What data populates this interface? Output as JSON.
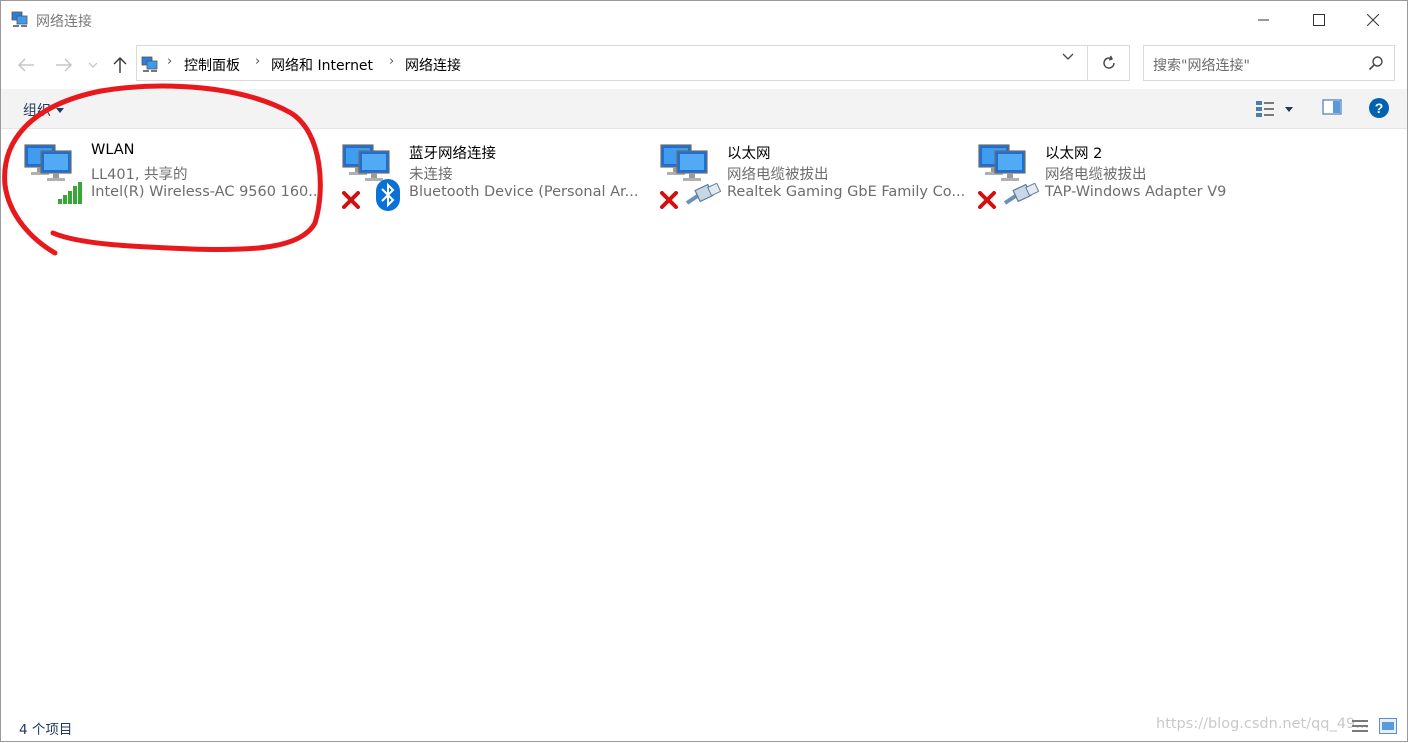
{
  "window": {
    "title": "网络连接"
  },
  "navigation": {
    "breadcrumbs": [
      "控制面板",
      "网络和 Internet",
      "网络连接"
    ],
    "search_placeholder": "搜索\"网络连接\""
  },
  "toolbar": {
    "organize_label": "组织"
  },
  "connections": [
    {
      "name": "WLAN",
      "status": "LL401, 共享的",
      "device": "Intel(R) Wireless-AC 9560 160...",
      "overlay": "wifi-signal-icon"
    },
    {
      "name": "蓝牙网络连接",
      "status": "未连接",
      "device": "Bluetooth Device (Personal Ar...",
      "overlay": "bluetooth-icon"
    },
    {
      "name": "以太网",
      "status": "网络电缆被拔出",
      "device": "Realtek Gaming GbE Family Co...",
      "overlay": "ethernet-cable-icon"
    },
    {
      "name": "以太网 2",
      "status": "网络电缆被拔出",
      "device": "TAP-Windows Adapter V9",
      "overlay": "ethernet-cable-icon"
    }
  ],
  "status_bar": {
    "item_count": "4 个项目",
    "watermark": "https://blog.csdn.net/qq_49..."
  },
  "colors": {
    "accent": "#0063b1",
    "annotation": "#e8191c",
    "error": "#d40f0f",
    "signal": "#3aa63a"
  }
}
